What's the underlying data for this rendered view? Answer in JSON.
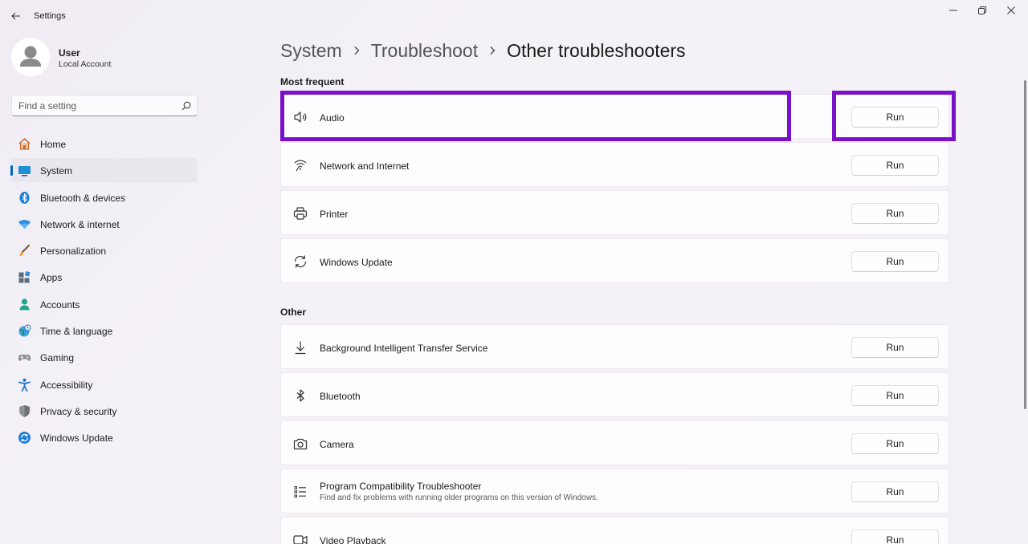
{
  "window": {
    "title": "Settings"
  },
  "user": {
    "name": "User",
    "account_type": "Local Account"
  },
  "search": {
    "placeholder": "Find a setting"
  },
  "sidebar": {
    "items": [
      {
        "label": "Home",
        "icon": "home-icon"
      },
      {
        "label": "System",
        "icon": "system-icon",
        "selected": true
      },
      {
        "label": "Bluetooth & devices",
        "icon": "bluetooth-icon"
      },
      {
        "label": "Network & internet",
        "icon": "wifi-icon"
      },
      {
        "label": "Personalization",
        "icon": "brush-icon"
      },
      {
        "label": "Apps",
        "icon": "apps-icon"
      },
      {
        "label": "Accounts",
        "icon": "person-icon"
      },
      {
        "label": "Time & language",
        "icon": "globe-clock-icon"
      },
      {
        "label": "Gaming",
        "icon": "gamepad-icon"
      },
      {
        "label": "Accessibility",
        "icon": "accessibility-icon"
      },
      {
        "label": "Privacy & security",
        "icon": "shield-icon"
      },
      {
        "label": "Windows Update",
        "icon": "update-icon"
      }
    ]
  },
  "breadcrumb": {
    "items": [
      "System",
      "Troubleshoot"
    ],
    "current": "Other troubleshooters"
  },
  "sections": {
    "most_frequent": {
      "title": "Most frequent",
      "items": [
        {
          "label": "Audio",
          "icon": "speaker-icon",
          "button": "Run"
        },
        {
          "label": "Network and Internet",
          "icon": "network-icon",
          "button": "Run"
        },
        {
          "label": "Printer",
          "icon": "printer-icon",
          "button": "Run"
        },
        {
          "label": "Windows Update",
          "icon": "refresh-icon",
          "button": "Run"
        }
      ]
    },
    "other": {
      "title": "Other",
      "items": [
        {
          "label": "Background Intelligent Transfer Service",
          "icon": "download-icon",
          "button": "Run"
        },
        {
          "label": "Bluetooth",
          "icon": "bluetooth-icon",
          "button": "Run"
        },
        {
          "label": "Camera",
          "icon": "camera-icon",
          "button": "Run"
        },
        {
          "label": "Program Compatibility Troubleshooter",
          "description": "Find and fix problems with running older programs on this version of Windows.",
          "icon": "list-icon",
          "button": "Run"
        },
        {
          "label": "Video Playback",
          "icon": "video-icon",
          "button": "Run"
        }
      ]
    }
  },
  "colors": {
    "accent": "#0067c0",
    "highlight": "#7a10c8"
  }
}
